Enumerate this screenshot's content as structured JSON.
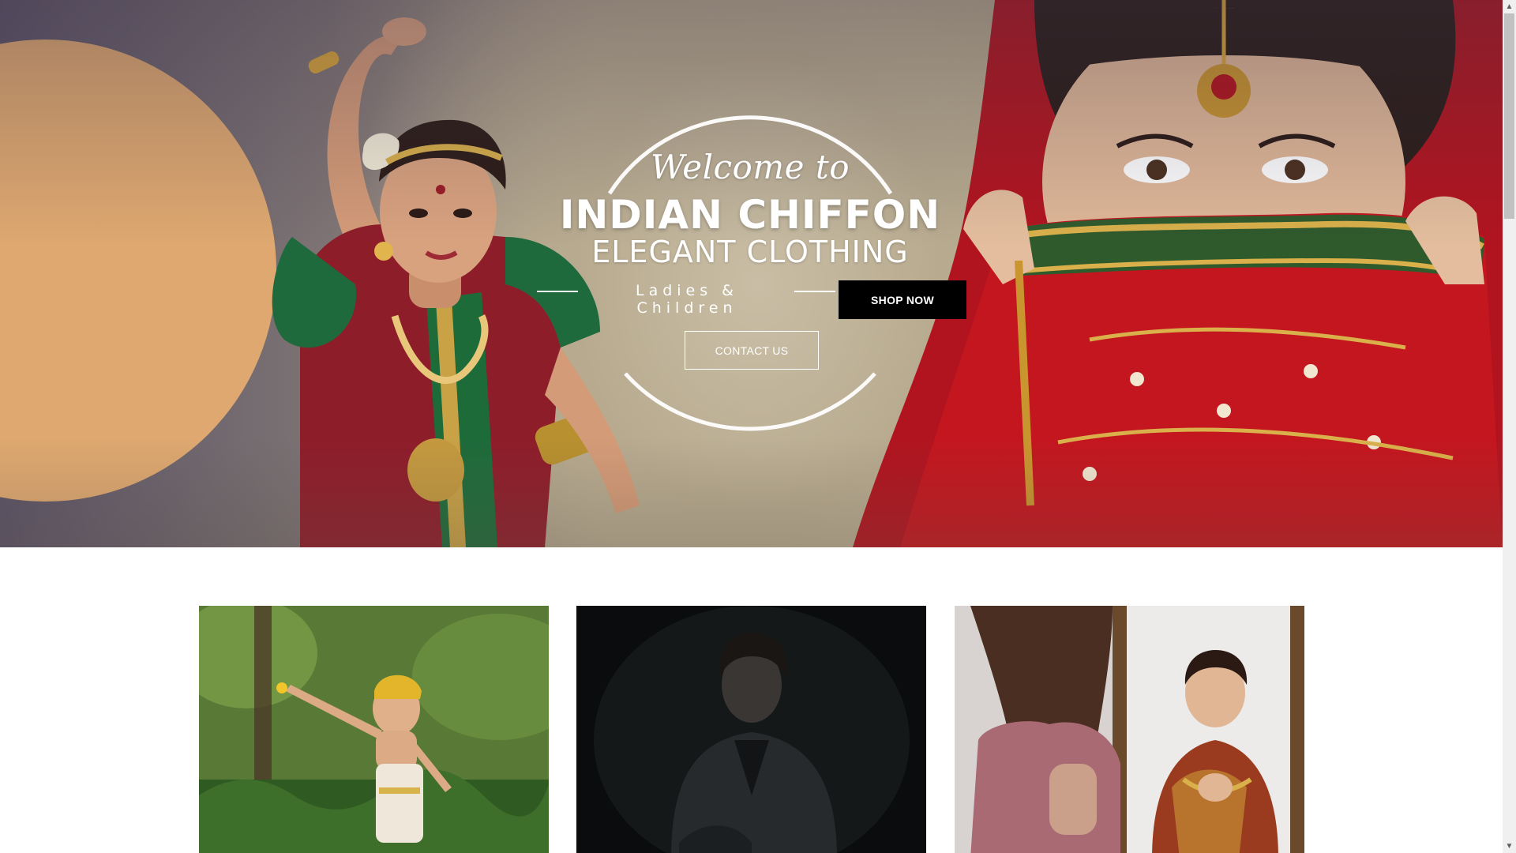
{
  "hero": {
    "welcome": "Welcome to",
    "brand": "INDIAN CHIFFON",
    "tagline": "ELEGANT CLOTHING",
    "subtitle": "Ladies & Children",
    "shop_button": "SHOP NOW",
    "contact_button": "CONTACT US",
    "accent_circle_color": "#dea870",
    "images": [
      "bharatanatyam-dancer-image",
      "veiled-bride-image"
    ]
  },
  "cards": [
    {
      "name": "children-collection-card",
      "image": "child-in-garden-image"
    },
    {
      "name": "men-collection-card",
      "image": "man-in-dark-blazer-image"
    },
    {
      "name": "ladies-collection-card",
      "image": "woman-draping-saree-mirror-image"
    }
  ],
  "scrollbar": {
    "up_glyph": "▲",
    "down_glyph": "▼"
  }
}
